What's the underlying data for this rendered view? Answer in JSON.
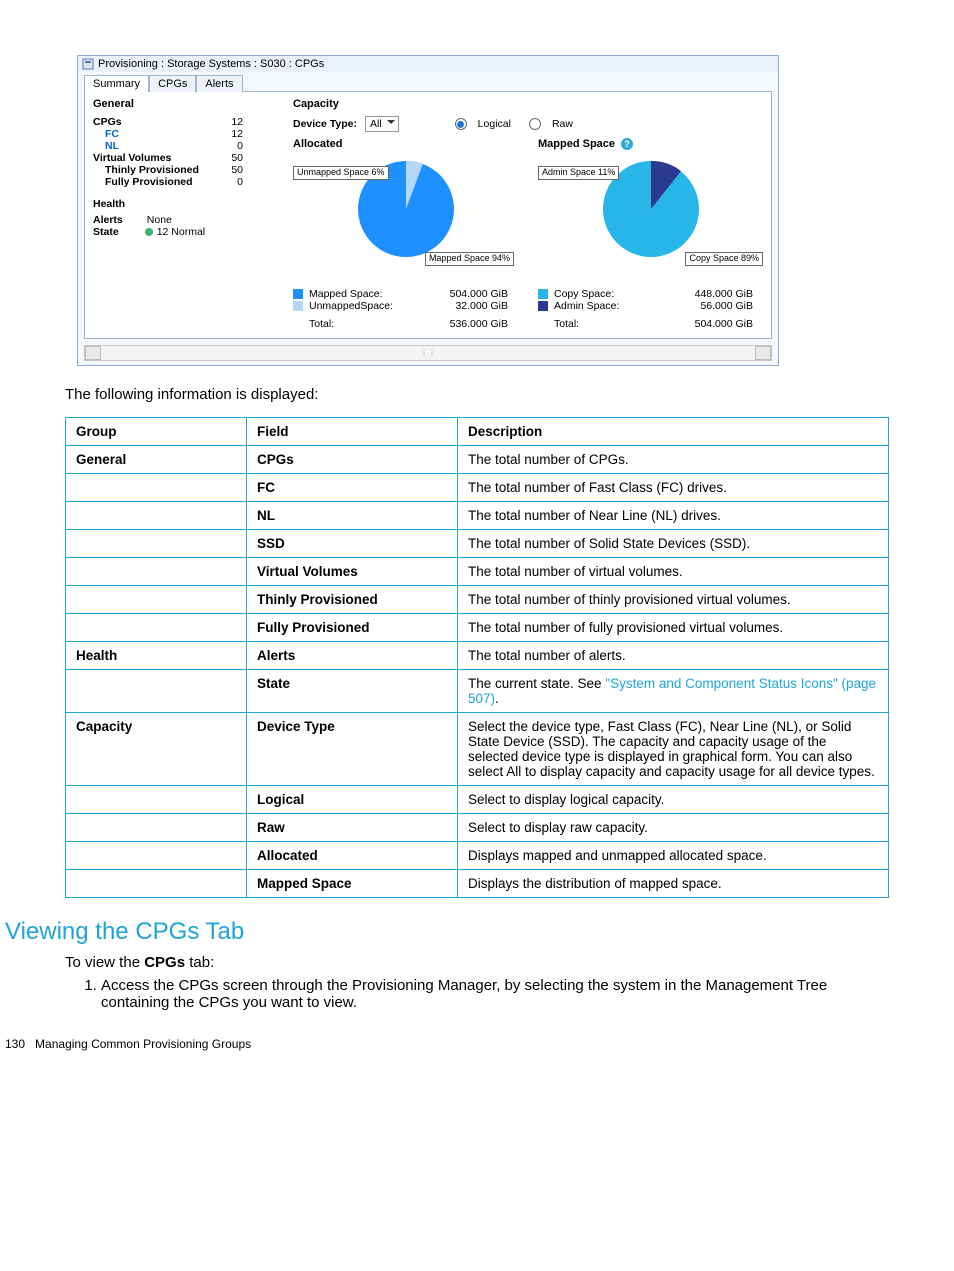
{
  "window": {
    "title": "Provisioning : Storage Systems : S030 : CPGs",
    "tabs": {
      "summary": "Summary",
      "cpgs": "CPGs",
      "alerts": "Alerts"
    }
  },
  "general": {
    "heading": "General",
    "cpgs_label": "CPGs",
    "cpgs_val": "12",
    "fc_label": "FC",
    "fc_val": "12",
    "nl_label": "NL",
    "nl_val": "0",
    "vv_label": "Virtual Volumes",
    "vv_val": "50",
    "thin_label": "Thinly Provisioned",
    "thin_val": "50",
    "full_label": "Fully Provisioned",
    "full_val": "0"
  },
  "health": {
    "heading": "Health",
    "alerts_label": "Alerts",
    "alerts_val": "None",
    "state_label": "State",
    "state_val": "12 Normal"
  },
  "capacity": {
    "heading": "Capacity",
    "device_type_label": "Device Type:",
    "device_type_value": "All",
    "logical_label": "Logical",
    "raw_label": "Raw",
    "allocated": {
      "title": "Allocated",
      "unmapped_lbl": "Unmapped Space 6%",
      "mapped_lbl": "Mapped Space 94%",
      "legend_mapped": "Mapped Space:",
      "legend_mapped_val": "504.000 GiB",
      "legend_unmapped": "UnmappedSpace:",
      "legend_unmapped_val": "32.000 GiB",
      "total_label": "Total:",
      "total_val": "536.000 GiB"
    },
    "mapped": {
      "title": "Mapped Space",
      "admin_lbl": "Admin Space 11%",
      "copy_lbl": "Copy Space 89%",
      "legend_copy": "Copy Space:",
      "legend_copy_val": "448.000 GiB",
      "legend_admin": "Admin Space:",
      "legend_admin_val": "56.000 GiB",
      "total_label": "Total:",
      "total_val": "504.000 GiB"
    }
  },
  "chart_data": [
    {
      "type": "pie",
      "title": "Allocated",
      "series": [
        {
          "name": "Mapped Space",
          "value": 504.0,
          "unit": "GiB",
          "percent": 94
        },
        {
          "name": "Unmapped Space",
          "value": 32.0,
          "unit": "GiB",
          "percent": 6
        }
      ],
      "total": {
        "label": "Total",
        "value": 536.0,
        "unit": "GiB"
      }
    },
    {
      "type": "pie",
      "title": "Mapped Space",
      "series": [
        {
          "name": "Copy Space",
          "value": 448.0,
          "unit": "GiB",
          "percent": 89
        },
        {
          "name": "Admin Space",
          "value": 56.0,
          "unit": "GiB",
          "percent": 11
        }
      ],
      "total": {
        "label": "Total",
        "value": 504.0,
        "unit": "GiB"
      }
    }
  ],
  "intro": "The following information is displayed:",
  "table": {
    "head": {
      "group": "Group",
      "field": "Field",
      "desc": "Description"
    },
    "rows": [
      {
        "group": "General",
        "field": "CPGs",
        "desc": "The total number of CPGs."
      },
      {
        "group": "",
        "field": "FC",
        "desc": "The total number of Fast Class (FC) drives."
      },
      {
        "group": "",
        "field": "NL",
        "desc": "The total number of Near Line (NL) drives."
      },
      {
        "group": "",
        "field": "SSD",
        "desc": "The total number of Solid State Devices (SSD)."
      },
      {
        "group": "",
        "field": "Virtual Volumes",
        "desc": "The total number of virtual volumes."
      },
      {
        "group": "",
        "field": "Thinly Provisioned",
        "desc": "The total number of thinly provisioned virtual volumes."
      },
      {
        "group": "",
        "field": "Fully Provisioned",
        "desc": "The total number of fully provisioned virtual volumes."
      },
      {
        "group": "Health",
        "field": "Alerts",
        "desc": "The total number of alerts."
      },
      {
        "group": "",
        "field": "State",
        "desc_pre": "The current state. See ",
        "desc_link": "\"System and Component Status Icons\" (page 507)",
        "desc_post": "."
      },
      {
        "group": "Capacity",
        "field": "Device Type",
        "desc": "Select the device type, Fast Class (FC), Near Line (NL), or Solid State Device (SSD). The capacity and capacity usage of the selected device type is displayed in graphical form. You can also select All to display capacity and capacity usage for all device types."
      },
      {
        "group": "",
        "field": "Logical",
        "desc": "Select to display logical capacity."
      },
      {
        "group": "",
        "field": "Raw",
        "desc": "Select to display raw capacity."
      },
      {
        "group": "",
        "field": "Allocated",
        "desc": "Displays mapped and unmapped allocated space."
      },
      {
        "group": "",
        "field": "Mapped Space",
        "desc": "Displays the distribution of mapped space."
      }
    ]
  },
  "sect2": {
    "title": "Viewing the CPGs Tab",
    "intro_pre": "To view the ",
    "intro_bold": "CPGs",
    "intro_post": " tab:",
    "step1": "Access the CPGs screen through the Provisioning Manager, by selecting the system in the Management Tree containing the CPGs you want to view."
  },
  "footer": {
    "page": "130",
    "chap": "Managing Common Provisioning Groups"
  }
}
